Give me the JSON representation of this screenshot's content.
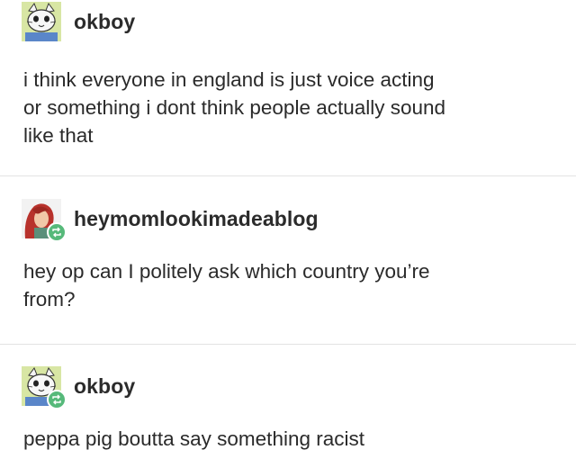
{
  "posts": [
    {
      "username": "okboy",
      "avatar_icon": "cat-avatar-icon",
      "reblog": false,
      "lines": [
        "i think everyone in england is just voice acting",
        "or something i dont think people actually sound",
        "like that"
      ]
    },
    {
      "username": "heymomlookimadeablog",
      "avatar_icon": "red-hair-avatar-icon",
      "reblog": true,
      "lines": [
        "hey op can I politely ask which country you’re",
        "from?"
      ]
    },
    {
      "username": "okboy",
      "avatar_icon": "cat-avatar-icon",
      "reblog": true,
      "lines": [
        "peppa pig boutta say something racist"
      ]
    }
  ],
  "colors": {
    "reblog_badge": "#56b97a",
    "divider": "#e3e3e3"
  }
}
